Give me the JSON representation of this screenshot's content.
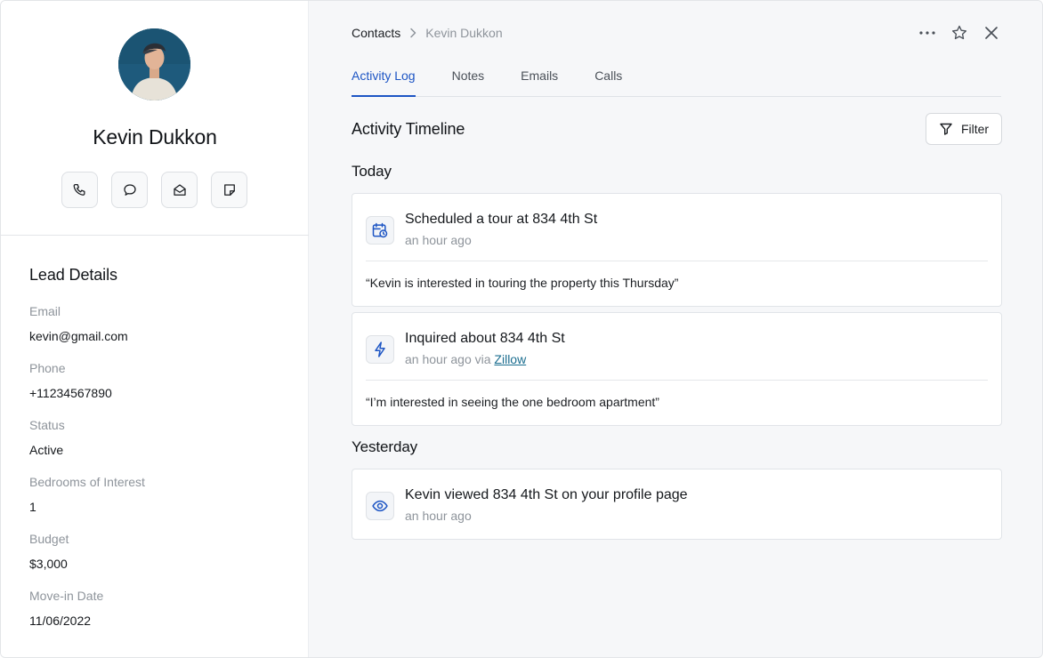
{
  "profile": {
    "name": "Kevin Dukkon",
    "actions": [
      "phone-icon",
      "message-icon",
      "mail-icon",
      "note-icon"
    ]
  },
  "lead": {
    "title": "Lead Details",
    "fields": [
      {
        "label": "Email",
        "value": "kevin@gmail.com"
      },
      {
        "label": "Phone",
        "value": "+11234567890"
      },
      {
        "label": "Status",
        "value": "Active"
      },
      {
        "label": "Bedrooms of Interest",
        "value": "1"
      },
      {
        "label": "Budget",
        "value": "$3,000"
      },
      {
        "label": "Move-in Date",
        "value": "11/06/2022"
      }
    ]
  },
  "breadcrumb": {
    "root": "Contacts",
    "current": "Kevin Dukkon"
  },
  "tabs": [
    {
      "label": "Activity Log",
      "active": true
    },
    {
      "label": "Notes",
      "active": false
    },
    {
      "label": "Emails",
      "active": false
    },
    {
      "label": "Calls",
      "active": false
    }
  ],
  "timeline": {
    "title": "Activity Timeline",
    "filter_label": "Filter",
    "groups": [
      {
        "label": "Today",
        "items": [
          {
            "icon": "calendar-clock-icon",
            "title": "Scheduled a tour at 834 4th St",
            "meta": "an hour ago",
            "note": "“Kevin is interested in touring the property this Thursday”"
          },
          {
            "icon": "lightning-icon",
            "title": "Inquired about 834 4th St",
            "meta": "an hour ago via",
            "meta_link": "Zillow",
            "note": "“I’m interested in seeing the one bedroom apartment”"
          }
        ]
      },
      {
        "label": "Yesterday",
        "items": [
          {
            "icon": "eye-icon",
            "title": "Kevin viewed 834 4th St on your profile page",
            "meta": "an hour ago"
          }
        ]
      }
    ]
  },
  "colors": {
    "accent": "#1d55c4",
    "link": "#1a6d8f",
    "muted": "#8e949b"
  }
}
